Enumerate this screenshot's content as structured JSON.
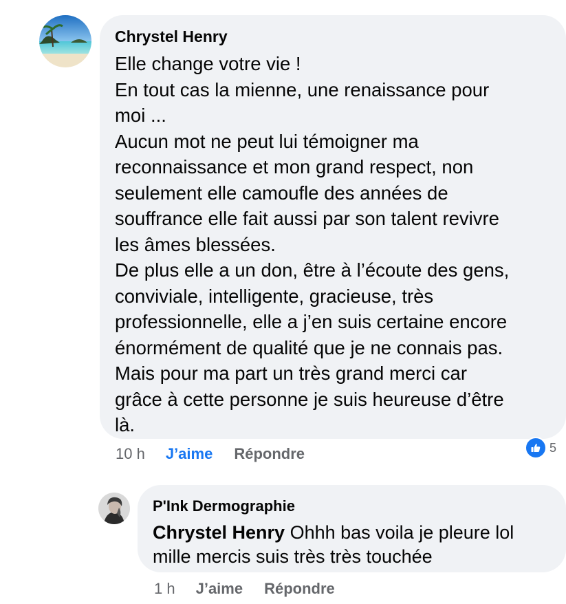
{
  "comment": {
    "author": "Chrystel Henry",
    "text": "Elle change votre vie !\nEn tout cas la mienne, une renaissance pour\nmoi ...\nAucun mot ne peut lui témoigner ma\nreconnaissance et mon grand respect, non\nseulement elle camoufle des années de\nsouffrance elle fait aussi par son talent revivre\nles âmes blessées.\nDe plus elle a un don, être à l’écoute des gens,\nconviviale, intelligente, gracieuse, très\nprofessionnelle, elle a j’en suis certaine encore\nénormément de qualité que je ne connais pas.\nMais pour ma part un très grand merci car\ngrâce à cette personne je suis heureuse d’être\nlà.",
    "time": "10 h",
    "like_label": "J’aime",
    "reply_label": "Répondre",
    "reaction_icon": "thumbs-up-icon",
    "reaction_count": "5",
    "like_color": "#1877f2"
  },
  "reply": {
    "author": "P'Ink Dermographie",
    "mention": "Chrystel Henry",
    "text_line1": " Ohhh bas voila je pleure lol",
    "text_line2": "mille mercis suis très très touchée",
    "time": "1 h",
    "like_label": "J’aime",
    "reply_label": "Répondre"
  },
  "colors": {
    "bubble": "#f0f2f5",
    "meta": "#65676b",
    "text": "#050505"
  }
}
